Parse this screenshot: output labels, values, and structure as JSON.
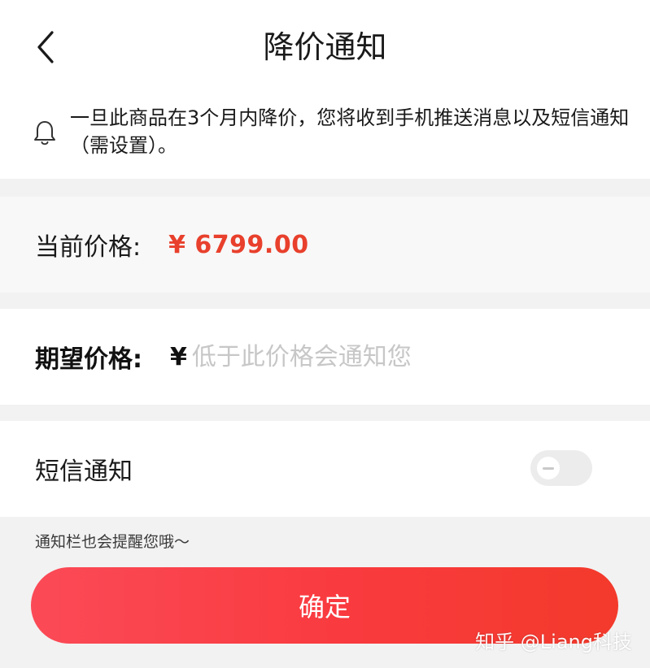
{
  "header": {
    "title": "降价通知"
  },
  "notice": {
    "text": "一旦此商品在3个月内降价，您将收到手机推送消息以及短信通知（需设置）。"
  },
  "current_price": {
    "label": "当前价格:",
    "value": "¥ 6799.00"
  },
  "expected_price": {
    "label": "期望价格:",
    "currency": "¥",
    "value": "",
    "placeholder": "低于此价格会通知您"
  },
  "sms": {
    "label": "短信通知",
    "enabled": false
  },
  "hint": "通知栏也会提醒您哦～",
  "confirm_label": "确定",
  "watermark": "知乎 @Liang科技",
  "colors": {
    "accent": "#f33a3e",
    "price": "#e8402c"
  }
}
